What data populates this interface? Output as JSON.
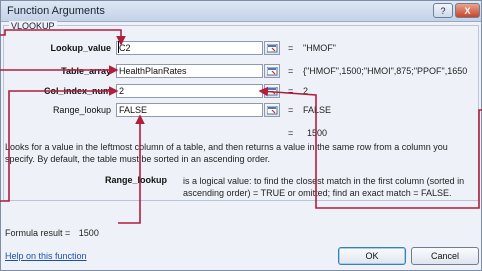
{
  "window": {
    "title": "Function Arguments",
    "help_btn": "?",
    "close_btn": "X"
  },
  "function_name": "VLOOKUP",
  "args": [
    {
      "label": "Lookup_value",
      "value": "C2",
      "result": "\"HMOF\""
    },
    {
      "label": "Table_array",
      "value": "HealthPlanRates",
      "result": "{\"HMOF\",1500;\"HMOI\",875;\"PPOF\",1650"
    },
    {
      "label": "Col_index_num",
      "value": "2",
      "result": "2"
    },
    {
      "label": "Range_lookup",
      "value": "FALSE",
      "result": "FALSE"
    }
  ],
  "function_result": "1500",
  "description": "Looks for a value in the leftmost column of a table, and then returns a value in the same row from a column you specify. By default, the table must be sorted in an ascending order.",
  "arg_help": {
    "name": "Range_lookup",
    "text": "is a logical value: to find the closest match in the first column (sorted in ascending order) = TRUE or omitted; find an exact match = FALSE."
  },
  "formula_result": {
    "label": "Formula result =",
    "value": "1500"
  },
  "help_link": "Help on this function",
  "buttons": {
    "ok": "OK",
    "cancel": "Cancel"
  },
  "eq_sign": "=",
  "colors": {
    "annotation": "#b01e3c"
  }
}
